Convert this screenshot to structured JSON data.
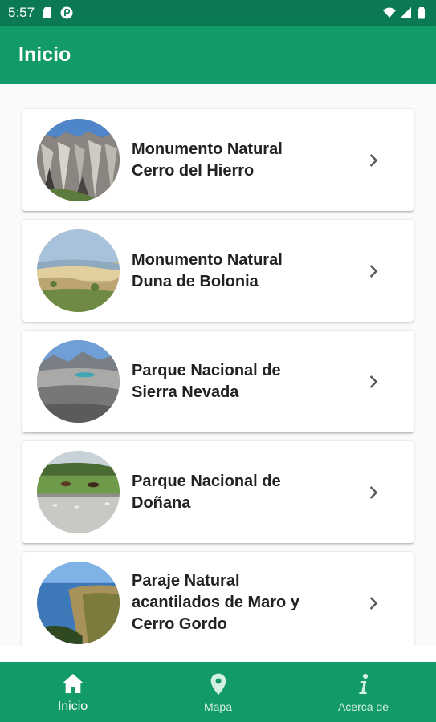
{
  "status_bar": {
    "time": "5:57"
  },
  "app_bar": {
    "title": "Inicio"
  },
  "places": [
    {
      "line1": "Monumento Natural",
      "line2": "Cerro del Hierro",
      "line3": ""
    },
    {
      "line1": "Monumento Natural",
      "line2": "Duna de Bolonia",
      "line3": ""
    },
    {
      "line1": "Parque Nacional de",
      "line2": "Sierra Nevada",
      "line3": ""
    },
    {
      "line1": "Parque Nacional de",
      "line2": "Doñana",
      "line3": ""
    },
    {
      "line1": "Paraje Natural",
      "line2": "acantilados de Maro y",
      "line3": "Cerro Gordo"
    }
  ],
  "bottom_nav": {
    "home_label": "Inicio",
    "map_label": "Mapa",
    "about_label": "Acerca de"
  },
  "colors": {
    "primary": "#129b68",
    "primary_dark": "#0b7a52"
  },
  "icons": {
    "status": [
      "sd-card-icon",
      "notification-p-icon",
      "wifi-icon",
      "signal-icon",
      "battery-icon"
    ],
    "card": "chevron-right-icon",
    "nav": [
      "home-icon",
      "map-pin-icon",
      "info-icon"
    ]
  }
}
